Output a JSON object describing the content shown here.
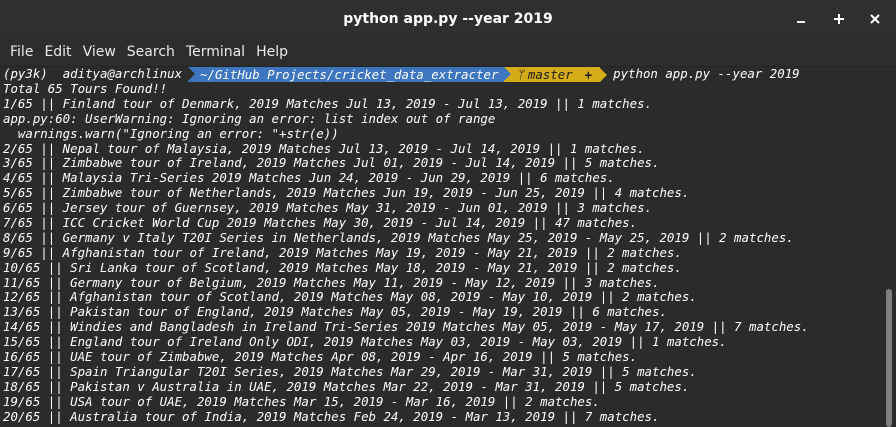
{
  "window": {
    "title": "python app.py --year 2019",
    "minimize_glyph": "–",
    "maximize_glyph": "+",
    "close_glyph": "✕"
  },
  "menubar": {
    "items": [
      {
        "label": "File"
      },
      {
        "label": "Edit"
      },
      {
        "label": "View"
      },
      {
        "label": "Search"
      },
      {
        "label": "Terminal"
      },
      {
        "label": "Help"
      }
    ]
  },
  "prompt": {
    "env": "(py3k)",
    "user_host": "aditya@archlinux",
    "path": "~/GitHub Projects/cricket_data_extracter",
    "branch_icon": "ᛘ",
    "branch": "master",
    "git_status": "+",
    "command": "python app.py --year 2019"
  },
  "output": [
    "Total 65 Tours Found!!",
    "1/65 || Finland tour of Denmark, 2019 Matches Jul 13, 2019 - Jul 13, 2019 || 1 matches.",
    "app.py:60: UserWarning: Ignoring an error: list index out of range",
    "  warnings.warn(\"Ignoring an error: \"+str(e))",
    "2/65 || Nepal tour of Malaysia, 2019 Matches Jul 13, 2019 - Jul 14, 2019 || 1 matches.",
    "3/65 || Zimbabwe tour of Ireland, 2019 Matches Jul 01, 2019 - Jul 14, 2019 || 5 matches.",
    "4/65 || Malaysia Tri-Series 2019 Matches Jun 24, 2019 - Jun 29, 2019 || 6 matches.",
    "5/65 || Zimbabwe tour of Netherlands, 2019 Matches Jun 19, 2019 - Jun 25, 2019 || 4 matches.",
    "6/65 || Jersey tour of Guernsey, 2019 Matches May 31, 2019 - Jun 01, 2019 || 3 matches.",
    "7/65 || ICC Cricket World Cup 2019 Matches May 30, 2019 - Jul 14, 2019 || 47 matches.",
    "8/65 || Germany v Italy T20I Series in Netherlands, 2019 Matches May 25, 2019 - May 25, 2019 || 2 matches.",
    "9/65 || Afghanistan tour of Ireland, 2019 Matches May 19, 2019 - May 21, 2019 || 2 matches.",
    "10/65 || Sri Lanka tour of Scotland, 2019 Matches May 18, 2019 - May 21, 2019 || 2 matches.",
    "11/65 || Germany tour of Belgium, 2019 Matches May 11, 2019 - May 12, 2019 || 3 matches.",
    "12/65 || Afghanistan tour of Scotland, 2019 Matches May 08, 2019 - May 10, 2019 || 2 matches.",
    "13/65 || Pakistan tour of England, 2019 Matches May 05, 2019 - May 19, 2019 || 6 matches.",
    "14/65 || Windies and Bangladesh in Ireland Tri-Series 2019 Matches May 05, 2019 - May 17, 2019 || 7 matches.",
    "15/65 || England tour of Ireland Only ODI, 2019 Matches May 03, 2019 - May 03, 2019 || 1 matches.",
    "16/65 || UAE tour of Zimbabwe, 2019 Matches Apr 08, 2019 - Apr 16, 2019 || 5 matches.",
    "17/65 || Spain Triangular T20I Series, 2019 Matches Mar 29, 2019 - Mar 31, 2019 || 5 matches.",
    "18/65 || Pakistan v Australia in UAE, 2019 Matches Mar 22, 2019 - Mar 31, 2019 || 5 matches.",
    "19/65 || USA tour of UAE, 2019 Matches Mar 15, 2019 - Mar 16, 2019 || 2 matches.",
    "20/65 || Australia tour of India, 2019 Matches Feb 24, 2019 - Mar 13, 2019 || 7 matches."
  ]
}
